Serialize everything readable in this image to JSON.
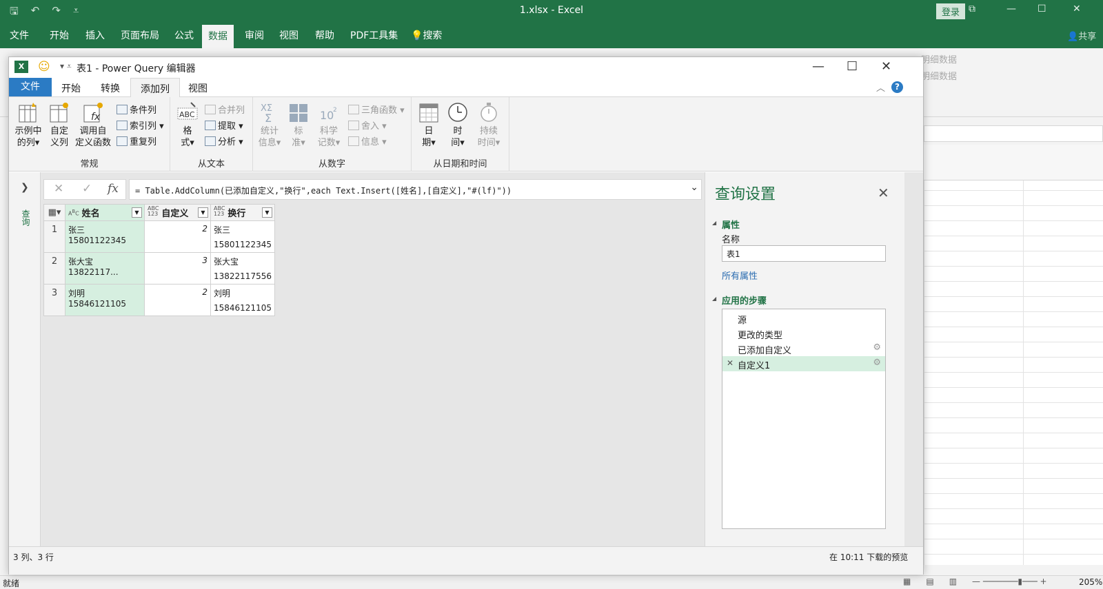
{
  "excel": {
    "title": "1.xlsx  -  Excel",
    "login": "登录",
    "tabs": [
      "文件",
      "开始",
      "插入",
      "页面布局",
      "公式",
      "数据",
      "审阅",
      "视图",
      "帮助",
      "PDF工具集",
      "搜索"
    ],
    "active_tab": "数据",
    "share": "共享",
    "ribbon_ghost": [
      "明细数据",
      "明细数据"
    ],
    "status_ready": "就绪",
    "zoom": "205%"
  },
  "pq": {
    "title": "表1 - Power Query 编辑器",
    "tabs": {
      "file": "文件",
      "home": "开始",
      "transform": "转换",
      "add_column": "添加列",
      "view": "视图"
    },
    "ribbon": {
      "general": {
        "name": "常规",
        "example_col": [
          "示例中",
          "的列▾"
        ],
        "custom_col": [
          "自定",
          "义列"
        ],
        "invoke_fn": [
          "调用自",
          "定义函数"
        ],
        "conditional": "条件列",
        "index": "索引列 ▾",
        "duplicate": "重复列"
      },
      "from_text": {
        "name": "从文本",
        "format": [
          "格",
          "式▾"
        ],
        "merge": "合并列",
        "extract": "提取 ▾",
        "parse": "分析 ▾"
      },
      "from_number": {
        "name": "从数字",
        "stats": [
          "统计",
          "信息▾"
        ],
        "standard": [
          "标",
          "准▾"
        ],
        "scientific": [
          "科学",
          "记数▾"
        ],
        "trig": "三角函数 ▾",
        "rounding": "舍入 ▾",
        "info": "信息 ▾"
      },
      "from_datetime": {
        "name": "从日期和时间",
        "date": [
          "日",
          "期▾"
        ],
        "time": [
          "时",
          "间▾"
        ],
        "duration": [
          "持续",
          "时间▾"
        ]
      }
    },
    "nav_label": "查询",
    "formula": "= Table.AddColumn(已添加自定义,\"换行\",each Text.Insert([姓名],[自定义],\"#(lf)\"))",
    "columns": [
      {
        "name": "姓名",
        "type": "ABC"
      },
      {
        "name": "自定义",
        "type": "ABC123"
      },
      {
        "name": "换行",
        "type": "ABC123"
      }
    ],
    "rows": [
      {
        "n": "1",
        "name": "张三15801122345",
        "custom": "2",
        "wrap1": "张三",
        "wrap2": "15801122345"
      },
      {
        "n": "2",
        "name": "张大宝13822117...",
        "custom": "3",
        "wrap1": "张大宝",
        "wrap2": "13822117556"
      },
      {
        "n": "3",
        "name": "刘明15846121105",
        "custom": "2",
        "wrap1": "刘明",
        "wrap2": "15846121105"
      }
    ],
    "settings": {
      "title": "查询设置",
      "properties": "属性",
      "name_label": "名称",
      "name_value": "表1",
      "all_props": "所有属性",
      "applied_steps": "应用的步骤",
      "steps": [
        "源",
        "更改的类型",
        "已添加自定义",
        "自定义1"
      ]
    },
    "status_left": "3 列、3 行",
    "status_right": "在 10:11 下载的预览"
  },
  "colors": {
    "excel_green": "#217346",
    "accent_blue": "#2b7bc4",
    "selected_col": "#d6efe0"
  }
}
